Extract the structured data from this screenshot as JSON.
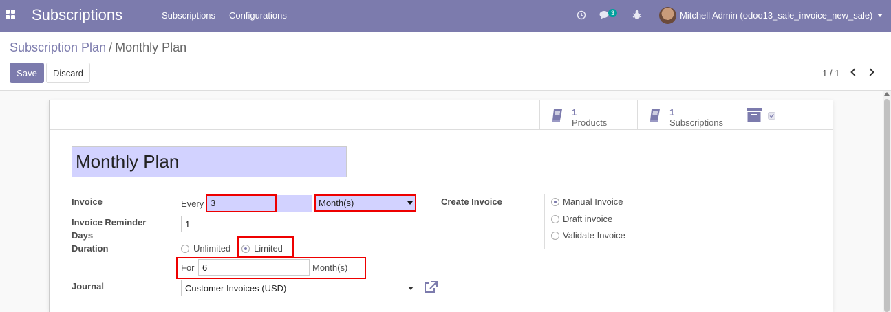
{
  "navbar": {
    "app_title": "Subscriptions",
    "menu": [
      "Subscriptions",
      "Configurations"
    ],
    "messages_badge": "3",
    "user_name": "Mitchell Admin (odoo13_sale_invoice_new_sale)",
    "icons": [
      "apps-icon",
      "clock-icon",
      "chat-icon",
      "bug-icon"
    ]
  },
  "breadcrumb": {
    "parent": "Subscription Plan",
    "separator": "/",
    "current": "Monthly Plan"
  },
  "buttons": {
    "save": "Save",
    "discard": "Discard"
  },
  "pager": {
    "value": "1 / 1"
  },
  "smart_buttons": [
    {
      "value": "1",
      "label": "Products",
      "icon": "book-icon"
    },
    {
      "value": "1",
      "label": "Subscriptions",
      "icon": "book-icon"
    }
  ],
  "form": {
    "name": "Monthly Plan",
    "invoice_label": "Invoice",
    "every_label": "Every",
    "interval_value": "3",
    "interval_unit": "Month(s)",
    "reminder_label_1": "Invoice Reminder",
    "reminder_label_2": "Days",
    "reminder_value": "1",
    "duration_label": "Duration",
    "duration_options": [
      "Unlimited",
      "Limited"
    ],
    "duration_selected": "Limited",
    "for_label": "For",
    "for_value": "6",
    "for_unit": "Month(s)",
    "journal_label": "Journal",
    "journal_value": "Customer Invoices (USD)",
    "create_invoice_label": "Create Invoice",
    "create_invoice_options": [
      "Manual Invoice",
      "Draft invoice",
      "Validate Invoice"
    ],
    "create_invoice_selected": "Manual Invoice"
  },
  "colors": {
    "brand": "#7c7bad",
    "required_field": "#d2d2ff",
    "highlight": "#e00000",
    "badge": "#00a09d"
  }
}
